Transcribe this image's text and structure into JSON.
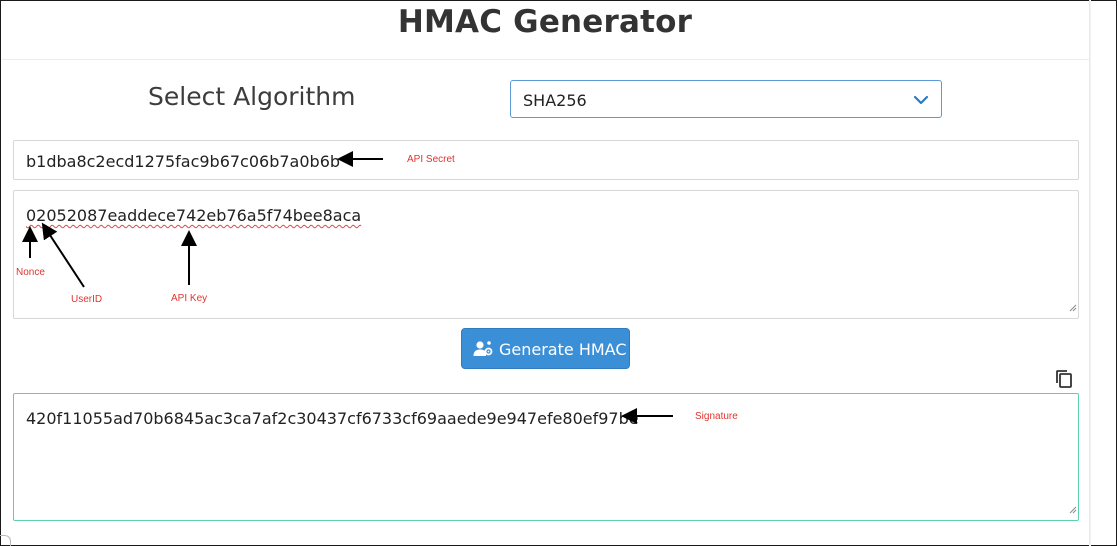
{
  "page": {
    "title": "HMAC Generator"
  },
  "algorithm": {
    "label": "Select Algorithm",
    "selected": "SHA256"
  },
  "fields": {
    "api_secret_value": "b1dba8c2ecd1275fac9b67c06b7a0b6b",
    "message_value": "02052087eaddece742eb76a5f74bee8aca",
    "signature_value": "420f11055ad70b6845ac3ca7af2c30437cf6733cf69aaede9e947efe80ef97be"
  },
  "button": {
    "label": "Generate HMAC",
    "icon": "user-gear-icon"
  },
  "copy": {
    "icon": "copy-icon"
  },
  "annotations": {
    "api_secret": "API Secret",
    "nonce": "Nonce",
    "user_id": "UserID",
    "api_key": "API Key",
    "signature": "Signature"
  },
  "colors": {
    "button": "#3b8fd6",
    "select_border": "#5b9bd5",
    "signature_border": "#5ed1ab",
    "annotation": "#e0342f"
  }
}
